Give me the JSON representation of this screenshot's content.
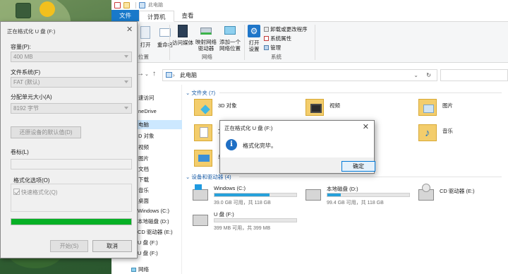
{
  "colors": {
    "accent": "#1979ca",
    "drive_bar": "#26a0da",
    "progress": "#06b025",
    "info_icon": "#1f6fc4"
  },
  "explorer": {
    "title": "此电脑",
    "tabs": [
      "文件",
      "计算机",
      "查看"
    ],
    "ribbon": {
      "partial_buttons": [
        "打开",
        "重命名"
      ],
      "left_group_label": "位置",
      "network_buttons": [
        "访问媒体",
        "映射网络\n驱动器",
        "添加一个\n网络位置"
      ],
      "network_group_label": "网络",
      "open_settings": "打开\n设置",
      "system_items": [
        "卸载或更改程序",
        "系统属性",
        "管理"
      ],
      "system_group_label": "系统"
    },
    "address": "此电脑",
    "nav_items": [
      {
        "label": "速访问",
        "icon": "star-icon"
      },
      {
        "label": "neDrive",
        "icon": "cloud-icon"
      },
      {
        "label": "电脑",
        "icon": "pc-icon",
        "selected": true
      },
      {
        "label": "D 对象",
        "icon": "cube-icon"
      },
      {
        "label": "视频",
        "icon": "video-icon"
      },
      {
        "label": "图片",
        "icon": "picture-icon"
      },
      {
        "label": "文档",
        "icon": "document-icon"
      },
      {
        "label": "下载",
        "icon": "download-icon"
      },
      {
        "label": "音乐",
        "icon": "music-icon"
      },
      {
        "label": "桌面",
        "icon": "desktop-icon"
      },
      {
        "label": "Windows (C:)",
        "icon": "drive-icon"
      },
      {
        "label": "本地磁盘 (D:)",
        "icon": "drive-icon"
      },
      {
        "label": "CD 驱动器 (E:)",
        "icon": "cd-icon"
      },
      {
        "label": "U 盘 (F:)",
        "icon": "usb-icon"
      },
      {
        "label": "U 盘 (F:)",
        "icon": "usb-icon"
      },
      {
        "label": "网络",
        "icon": "network-icon"
      }
    ],
    "folders_header": "文件夹 (7)",
    "folders": [
      {
        "name": "3D 对象",
        "icon": "3d-objects-icon"
      },
      {
        "name": "视频",
        "icon": "videos-folder-icon"
      },
      {
        "name": "图片",
        "icon": "pictures-folder-icon"
      },
      {
        "name": "文",
        "icon": "documents-folder-icon"
      },
      {
        "name": "音乐",
        "icon": "music-folder-icon"
      },
      {
        "name": "桌",
        "icon": "desktop-folder-icon"
      }
    ],
    "drives_header": "设备和驱动器 (4)",
    "drives": [
      {
        "name": "Windows (C:)",
        "info": "39.0 GB 可用，共 118 GB",
        "used_fraction": 0.67,
        "icon": "windows-drive-icon"
      },
      {
        "name": "本地磁盘 (D:)",
        "info": "99.4 GB 可用，共 118 GB",
        "used_fraction": 0.16,
        "icon": "hdd-icon"
      },
      {
        "name": "CD 驱动器 (E:)",
        "info": "",
        "icon": "cd-drive-icon"
      },
      {
        "name": "U 盘 (F:)",
        "info": "399 MB 可用，共 399 MB",
        "used_fraction": 0.0,
        "icon": "usb-drive-icon"
      }
    ]
  },
  "format_dialog": {
    "title": "正在格式化 U 盘 (F:)",
    "capacity_label": "容量(P):",
    "capacity_value": "400 MB",
    "fs_label": "文件系统(F)",
    "fs_value": "FAT (默认)",
    "alloc_label": "分配单元大小(A)",
    "alloc_value": "8192 字节",
    "restore_button": "还原设备的默认值(D)",
    "volume_label": "卷标(L)",
    "volume_value": "",
    "options_label": "格式化选项(O)",
    "quick_format_label": "快速格式化(Q)",
    "progress": 1.0,
    "start_button": "开始(S)",
    "cancel_button": "取消"
  },
  "message_box": {
    "title": "正在格式化 U 盘 (F:)",
    "icon": "info-icon",
    "text": "格式化完毕。",
    "ok_button": "确定"
  }
}
